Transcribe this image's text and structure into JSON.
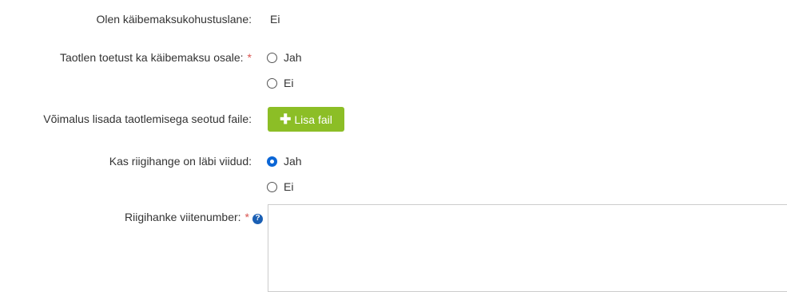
{
  "rows": {
    "vat_liable": {
      "label": "Olen käibemaksukohustuslane:",
      "value": "Ei"
    },
    "vat_support": {
      "label": "Taotlen toetust ka käibemaksu osale:",
      "required_mark": "*",
      "options": [
        {
          "label": "Jah",
          "checked": false
        },
        {
          "label": "Ei",
          "checked": false
        }
      ]
    },
    "attachments": {
      "label": "Võimalus lisada taotlemisega seotud faile:",
      "button_label": "Lisa fail",
      "button_icon": "plus-icon",
      "button_color": "#8cbe26"
    },
    "procurement": {
      "label": "Kas riigihange on läbi viidud:",
      "options": [
        {
          "label": "Jah",
          "checked": true
        },
        {
          "label": "Ei",
          "checked": false
        }
      ]
    },
    "procurement_ref": {
      "label": "Riigihanke viitenumber:",
      "required_mark": "*",
      "help_icon": "question-circle-icon",
      "value": ""
    }
  },
  "colors": {
    "required": "#d9534f",
    "radio_checked": "#0b66d6",
    "help_icon": "#1a5fb4"
  }
}
